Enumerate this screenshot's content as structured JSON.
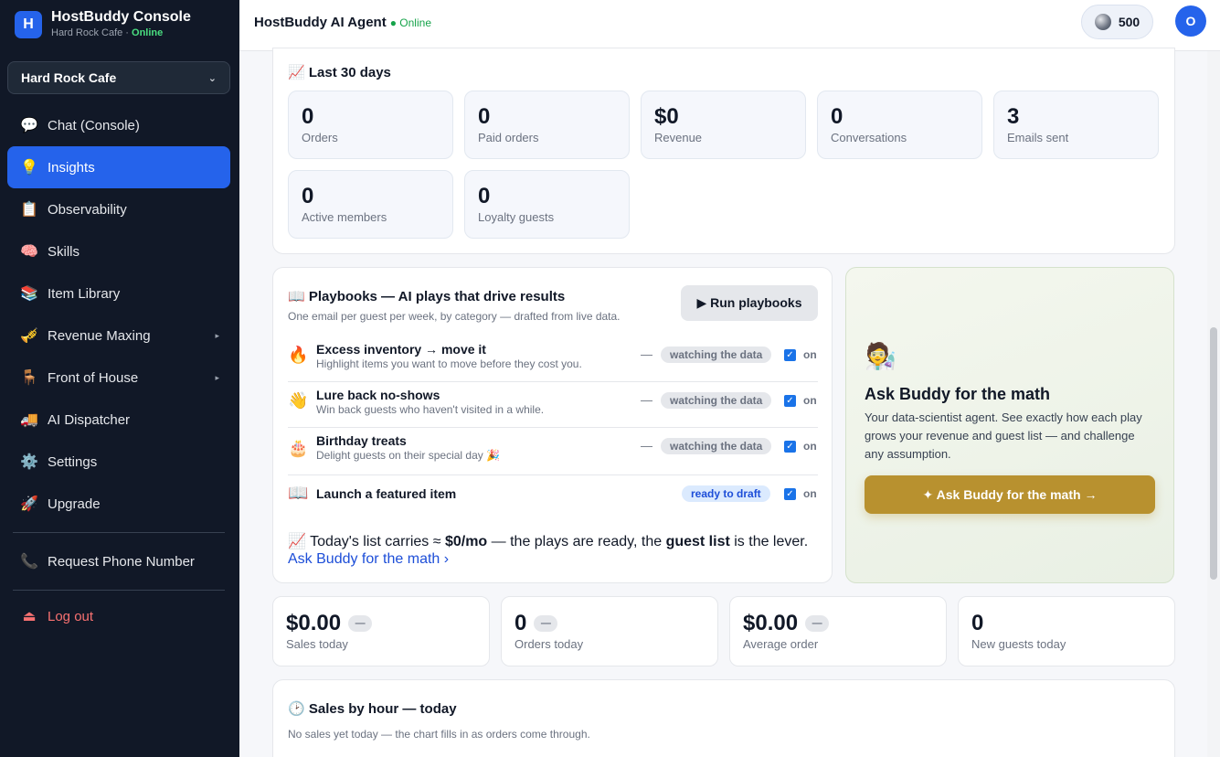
{
  "sidebar": {
    "brand": {
      "logo_letter": "H",
      "title": "HostBuddy Console",
      "subtitle_prefix": "Hard Rock Cafe · ",
      "status": "Online"
    },
    "location_select": {
      "value": "Hard Rock Cafe",
      "chevron": "⌄"
    },
    "items": [
      {
        "label": "Chat (Console)",
        "icon": "speech-bubble-icon",
        "glyph": "💬"
      },
      {
        "label": "Insights",
        "icon": "lightbulb-icon",
        "glyph": "💡",
        "active": true
      },
      {
        "label": "Observability",
        "icon": "clipboard-icon",
        "glyph": "📋"
      },
      {
        "label": "Skills",
        "icon": "brain-icon",
        "glyph": "🧠"
      },
      {
        "label": "Item Library",
        "icon": "books-icon",
        "glyph": "📚"
      },
      {
        "label": "Revenue Maxing",
        "icon": "trumpet-icon",
        "glyph": "🎺",
        "submenu": "▸"
      },
      {
        "label": "Front of House",
        "icon": "chair-icon",
        "glyph": "🪑",
        "submenu": "▸"
      },
      {
        "label": "AI Dispatcher",
        "icon": "delivery-truck-icon",
        "glyph": "🚚"
      },
      {
        "label": "Settings",
        "icon": "gear-icon",
        "glyph": "⚙️"
      },
      {
        "label": "Upgrade",
        "icon": "rocket-icon",
        "glyph": "🚀"
      }
    ],
    "phone": {
      "label": "Request Phone Number",
      "icon": "phone-icon",
      "glyph": "📞"
    },
    "logout": {
      "label": "Log out",
      "icon": "eject-icon",
      "glyph": "⏏"
    }
  },
  "topbar": {
    "title": "HostBuddy AI Agent",
    "status": "● Online",
    "credits": "500",
    "avatar_letter": "O"
  },
  "last30": {
    "title": "📈 Last 30 days",
    "stats": [
      {
        "value": "0",
        "label": "Orders"
      },
      {
        "value": "0",
        "label": "Paid orders"
      },
      {
        "value": "$0",
        "label": "Revenue"
      },
      {
        "value": "0",
        "label": "Conversations"
      },
      {
        "value": "3",
        "label": "Emails sent"
      },
      {
        "value": "0",
        "label": "Active members"
      },
      {
        "value": "0",
        "label": "Loyalty guests"
      }
    ]
  },
  "playbooks": {
    "title": "📖 Playbooks — AI plays that drive results",
    "subtitle": "One email per guest per week, by category — drafted from live data.",
    "run_button": "▶ Run playbooks",
    "rows": [
      {
        "emoji": "🔥",
        "name": "Excess inventory → move it",
        "desc": "Highlight items you want to move before they cost you.",
        "dash": "—",
        "status": "watching the data",
        "toggle": "on"
      },
      {
        "emoji": "👋",
        "name": "Lure back no-shows",
        "desc": "Win back guests who haven't visited in a while.",
        "dash": "—",
        "status": "watching the data",
        "toggle": "on"
      },
      {
        "emoji": "🎂",
        "name": "Birthday treats",
        "desc": "Delight guests on their special day 🎉",
        "dash": "—",
        "status": "watching the data",
        "toggle": "on"
      },
      {
        "emoji": "📖",
        "name": "Launch a featured item",
        "desc": "",
        "dash": "",
        "status": "ready to draft",
        "toggle": "on"
      }
    ],
    "carry": {
      "prefix": "📈 Today's list carries ≈ ",
      "amount": "$0/mo",
      "middle": " — the plays are ready, the ",
      "emphasis": "guest list",
      "suffix": " is the lever."
    },
    "link": "Ask Buddy for the math ›"
  },
  "buddy": {
    "emoji": "🧑‍🔬",
    "title": "Ask Buddy for the math",
    "desc": "Your data-scientist agent. See exactly how each play grows your revenue and guest list — and challenge any assumption.",
    "button": "✦ Ask Buddy for the math →"
  },
  "today": [
    {
      "value": "$0.00",
      "delta": "—",
      "label": "Sales today"
    },
    {
      "value": "0",
      "delta": "—",
      "label": "Orders today"
    },
    {
      "value": "$0.00",
      "delta": "—",
      "label": "Average order"
    },
    {
      "value": "0",
      "delta": "",
      "label": "New guests today"
    }
  ],
  "sales_by_hour": {
    "title": "🕑 Sales by hour — today",
    "subtitle": "No sales yet today — the chart fills in as orders come through."
  },
  "colors": {
    "sidebar_bg": "#111827",
    "accent": "#2563eb",
    "online": "#16a34a",
    "buddy_button": "#b8912f"
  }
}
